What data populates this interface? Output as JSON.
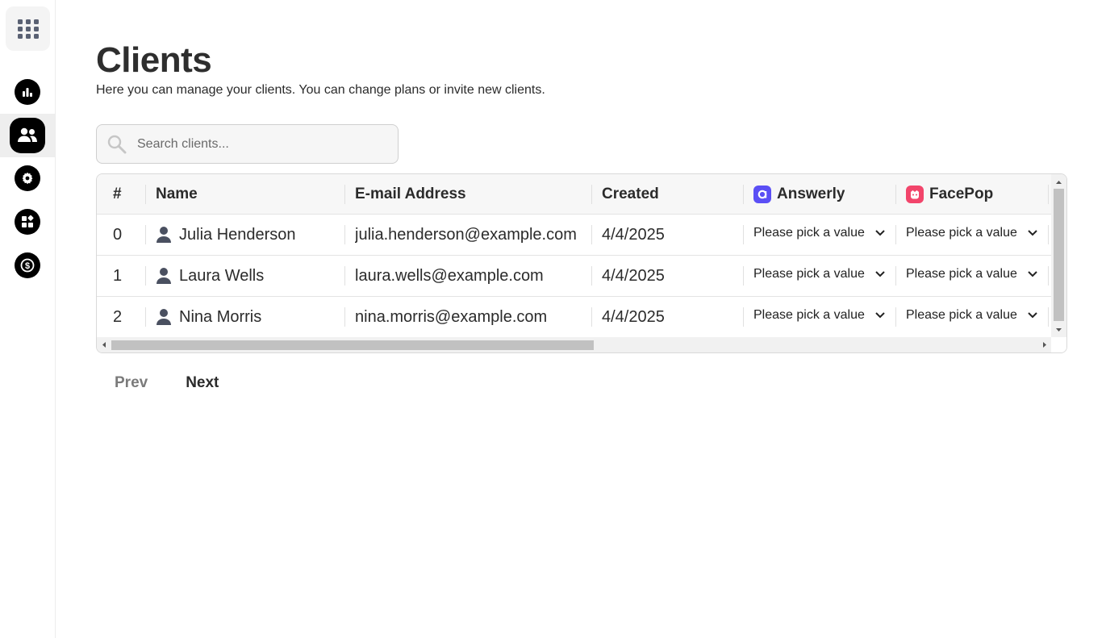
{
  "page": {
    "title": "Clients",
    "subtitle": "Here you can manage your clients. You can change plans or invite new clients."
  },
  "search": {
    "placeholder": "Search clients..."
  },
  "table": {
    "headers": {
      "index": "#",
      "name": "Name",
      "email": "E-mail Address",
      "created": "Created",
      "answerly": "Answerly",
      "facepop": "FacePop"
    },
    "rows": [
      {
        "index": "0",
        "name": "Julia Henderson",
        "email": "julia.henderson@example.com",
        "created": "4/4/2025",
        "answerly": "Please pick a value",
        "facepop": "Please pick a value"
      },
      {
        "index": "1",
        "name": "Laura Wells",
        "email": "laura.wells@example.com",
        "created": "4/4/2025",
        "answerly": "Please pick a value",
        "facepop": "Please pick a value"
      },
      {
        "index": "2",
        "name": "Nina Morris",
        "email": "nina.morris@example.com",
        "created": "4/4/2025",
        "answerly": "Please pick a value",
        "facepop": "Please pick a value"
      }
    ]
  },
  "pagination": {
    "prev": "Prev",
    "next": "Next"
  },
  "sidebar": {
    "items": [
      {
        "icon": "bar-chart-icon"
      },
      {
        "icon": "users-icon",
        "active": true
      },
      {
        "icon": "gear-icon"
      },
      {
        "icon": "widgets-icon"
      },
      {
        "icon": "dollar-icon"
      }
    ]
  },
  "colors": {
    "answerly_brand": "#5b4ff5",
    "facepop_brand": "#f2456b",
    "sidebar_icon_bg": "#000000"
  }
}
